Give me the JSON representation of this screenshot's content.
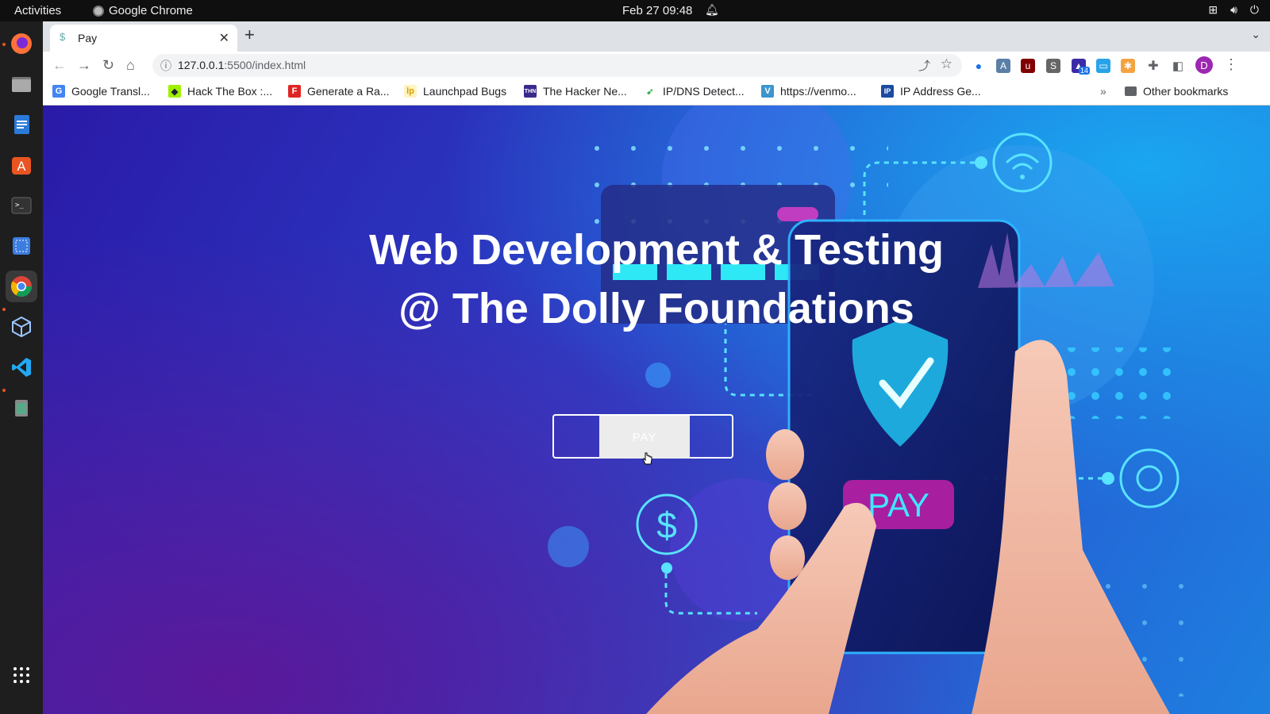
{
  "system": {
    "activities": "Activities",
    "app_name": "Google Chrome",
    "clock": "Feb 27  09:48"
  },
  "browser": {
    "tab_title": "Pay",
    "url_host": "127.0.0.1",
    "url_path": ":5500/index.html",
    "profile_initial": "D",
    "extension_badge": "14",
    "bookmarks": [
      {
        "label": "Google Transl...",
        "icon": "google-translate-icon",
        "color": "#4285f4"
      },
      {
        "label": "Hack The Box :...",
        "icon": "hackthebox-icon",
        "color": "#9fef00"
      },
      {
        "label": "Generate a Ra...",
        "icon": "f-icon",
        "color": "#e02424"
      },
      {
        "label": "Launchpad Bugs",
        "icon": "launchpad-icon",
        "color": "#f2c200"
      },
      {
        "label": "The Hacker Ne...",
        "icon": "hackernews-icon",
        "color": "#3a2a8c"
      },
      {
        "label": "IP/DNS Detect...",
        "icon": "ipdns-icon",
        "color": "#2ab04a"
      },
      {
        "label": "https://venmo...",
        "icon": "venmo-icon",
        "color": "#3d95ce"
      },
      {
        "label": "IP Address Ge...",
        "icon": "ip-address-icon",
        "color": "#1c4ba0"
      }
    ],
    "other_bookmarks": "Other bookmarks"
  },
  "page": {
    "title_line1": "Web Development & Testing",
    "title_line2": "@ The Dolly Foundations",
    "pay_button": "PAY"
  }
}
